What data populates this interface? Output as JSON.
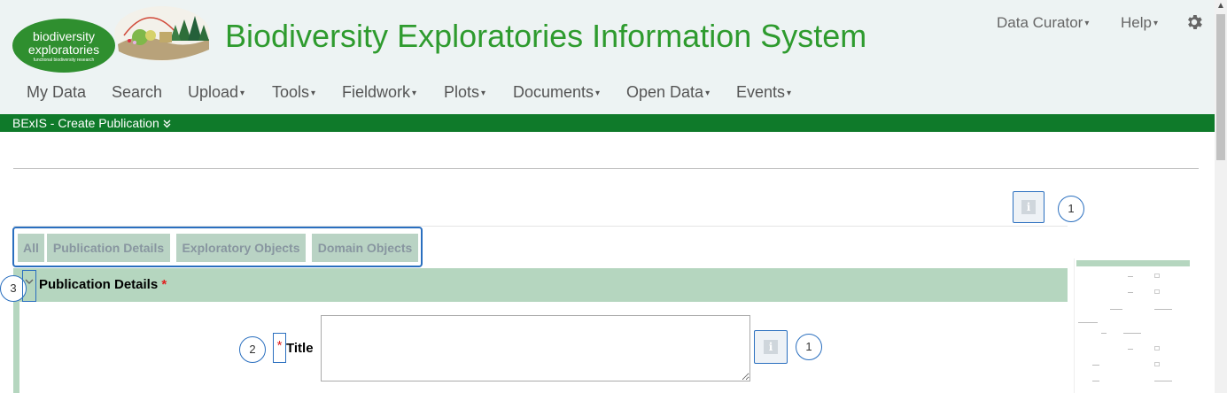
{
  "header": {
    "logo_line1": "biodiversity",
    "logo_line2": "exploratories",
    "logo_line3": "functional biodiversity research",
    "title": "Biodiversity Exploratories Information System",
    "user_menu": "Data Curator",
    "help_menu": "Help",
    "settings_icon": "gear-icon",
    "caret": "▾",
    "colors": {
      "title": "#2e9b2e",
      "header_bg": "#edf3f3",
      "brand_bar": "#0f7a2a"
    }
  },
  "nav": {
    "items": [
      "My Data",
      "Search",
      "Upload",
      "Tools",
      "Fieldwork",
      "Plots",
      "Documents",
      "Open Data",
      "Events"
    ]
  },
  "breadcrumb_bar": {
    "text": "BExIS - Create Publication",
    "icon": "double-chevron-down-icon"
  },
  "help_markers": {
    "info_1": "1",
    "info_2": "1",
    "field_marker": "2",
    "section_marker": "3"
  },
  "tabs": [
    "All",
    "Publication Details",
    "Exploratory Objects",
    "Domain Objects"
  ],
  "section": {
    "title": "Publication Details",
    "required_mark": "*",
    "toggle_icon": "chevron-down-icon"
  },
  "form": {
    "title_field": {
      "label": "Title",
      "required_mark": "*",
      "value": "",
      "info_icon": "info-icon"
    }
  }
}
